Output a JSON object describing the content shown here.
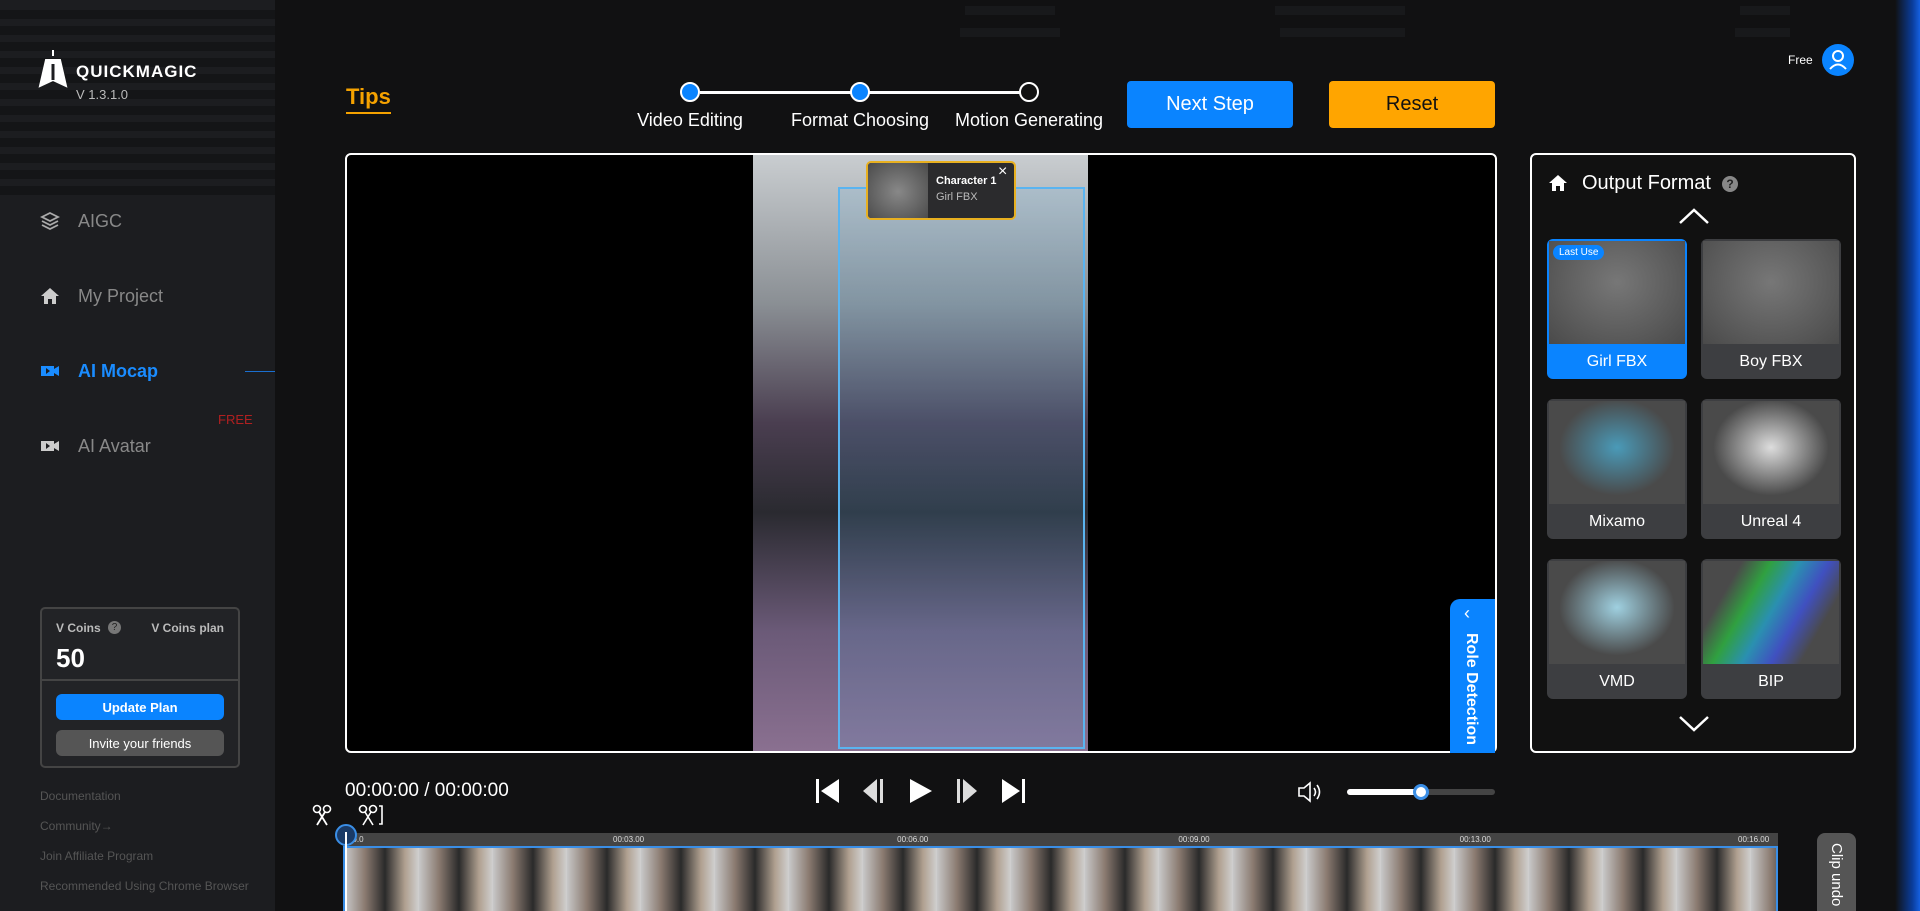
{
  "app": {
    "brand": "QUICKMAGIC",
    "version": "V 1.3.1.0"
  },
  "sidebar": {
    "items": [
      {
        "label": "AIGC",
        "icon": "layers-icon"
      },
      {
        "label": "My Project",
        "icon": "home-icon"
      },
      {
        "label": "AI Mocap",
        "icon": "video-camera-icon",
        "active": true
      },
      {
        "label": "AI Avatar",
        "icon": "video-camera-icon"
      }
    ],
    "free_badge": "FREE",
    "coins": {
      "label": "V Coins",
      "plan_label": "V Coins plan",
      "value": "50",
      "update_label": "Update Plan",
      "invite_label": "Invite your friends"
    },
    "links": [
      "Documentation",
      "Community→",
      "Join Affiliate Program",
      "Recommended Using Chrome Browser"
    ]
  },
  "header": {
    "tips": "Tips",
    "steps": [
      {
        "label": "Video Editing",
        "done": true
      },
      {
        "label": "Format Choosing",
        "done": true
      },
      {
        "label": "Motion Generating",
        "done": false
      }
    ],
    "next_label": "Next Step",
    "reset_label": "Reset",
    "user_plan": "Free"
  },
  "video": {
    "character_tag": {
      "title": "Character 1",
      "subtitle": "Girl FBX"
    },
    "role_detection": "Role Detection"
  },
  "output": {
    "title": "Output Format",
    "formats": [
      {
        "label": "Girl FBX",
        "selected": true,
        "badge": "Last Use"
      },
      {
        "label": "Boy FBX"
      },
      {
        "label": "Mixamo"
      },
      {
        "label": "Unreal 4"
      },
      {
        "label": "VMD"
      },
      {
        "label": "BIP"
      }
    ]
  },
  "player": {
    "time": "00:00:00 / 00:00:00",
    "volume": 0.5
  },
  "timeline": {
    "ticks": [
      "00:00.0",
      "00:03.00",
      "00:06.00",
      "00:09.00",
      "00:13.00",
      "00:16.00"
    ],
    "clip_undo": "Clip undo"
  },
  "colors": {
    "accent": "#0a84ff",
    "reset": "#ffa500",
    "tips": "#f5a200"
  }
}
